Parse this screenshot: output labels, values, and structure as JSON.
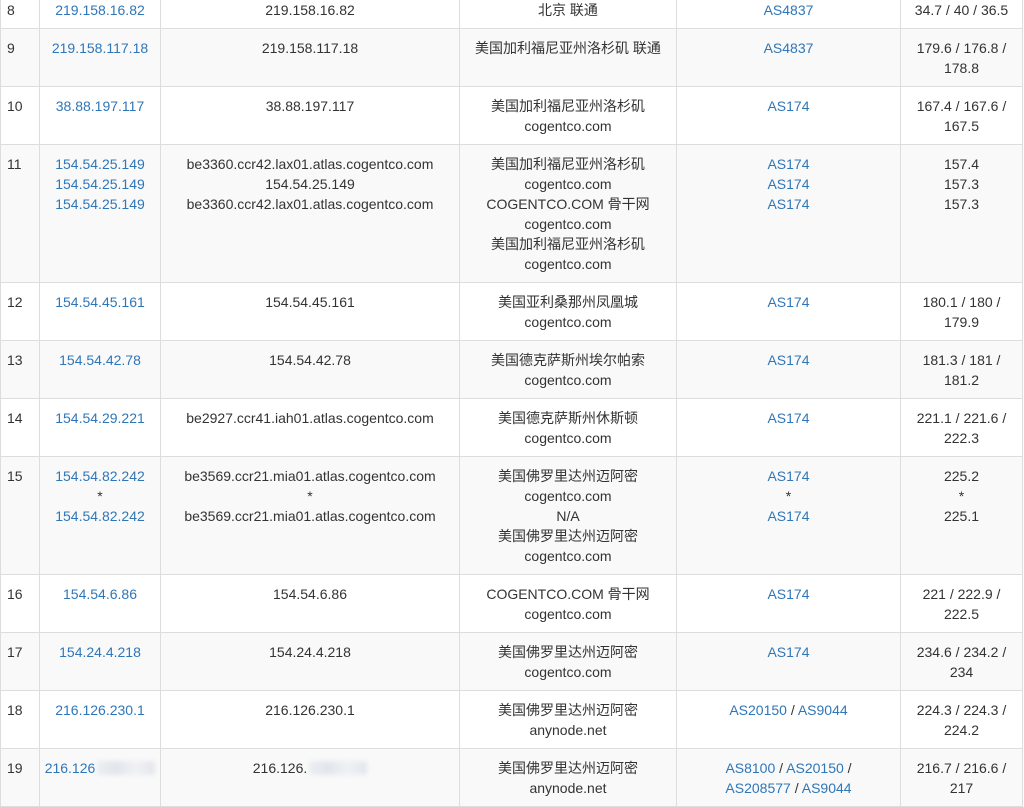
{
  "rows": [
    {
      "hop": "8",
      "ips": [
        "219.158.16.82"
      ],
      "hosts": [
        "219.158.16.82"
      ],
      "locs": [
        "北京 联通"
      ],
      "as": [
        [
          "AS4837"
        ]
      ],
      "rtt": [
        "34.7 / 40 / 36.5"
      ]
    },
    {
      "hop": "9",
      "ips": [
        "219.158.117.18"
      ],
      "hosts": [
        "219.158.117.18"
      ],
      "locs": [
        "美国加利福尼亚州洛杉矶 联通"
      ],
      "as": [
        [
          "AS4837"
        ]
      ],
      "rtt": [
        "179.6 / 176.8 /",
        "178.8"
      ]
    },
    {
      "hop": "10",
      "ips": [
        "38.88.197.117"
      ],
      "hosts": [
        "38.88.197.117"
      ],
      "locs": [
        "美国加利福尼亚州洛杉矶",
        "cogentco.com"
      ],
      "as": [
        [
          "AS174"
        ]
      ],
      "rtt": [
        "167.4 / 167.6 /",
        "167.5"
      ]
    },
    {
      "hop": "11",
      "ips": [
        "154.54.25.149",
        "154.54.25.149",
        "154.54.25.149"
      ],
      "hosts": [
        "be3360.ccr42.lax01.atlas.cogentco.com",
        "154.54.25.149",
        "be3360.ccr42.lax01.atlas.cogentco.com"
      ],
      "locs": [
        "美国加利福尼亚州洛杉矶",
        "cogentco.com",
        "COGENTCO.COM 骨干网",
        "cogentco.com",
        "美国加利福尼亚州洛杉矶",
        "cogentco.com"
      ],
      "as": [
        [
          "AS174"
        ],
        [
          "AS174"
        ],
        [
          "AS174"
        ]
      ],
      "rtt": [
        "157.4",
        "157.3",
        "157.3"
      ]
    },
    {
      "hop": "12",
      "ips": [
        "154.54.45.161"
      ],
      "hosts": [
        "154.54.45.161"
      ],
      "locs": [
        "美国亚利桑那州凤凰城",
        "cogentco.com"
      ],
      "as": [
        [
          "AS174"
        ]
      ],
      "rtt": [
        "180.1 / 180 /",
        "179.9"
      ]
    },
    {
      "hop": "13",
      "ips": [
        "154.54.42.78"
      ],
      "hosts": [
        "154.54.42.78"
      ],
      "locs": [
        "美国德克萨斯州埃尔帕索",
        "cogentco.com"
      ],
      "as": [
        [
          "AS174"
        ]
      ],
      "rtt": [
        "181.3 / 181 /",
        "181.2"
      ]
    },
    {
      "hop": "14",
      "ips": [
        "154.54.29.221"
      ],
      "hosts": [
        "be2927.ccr41.iah01.atlas.cogentco.com"
      ],
      "locs": [
        "美国德克萨斯州休斯顿",
        "cogentco.com"
      ],
      "as": [
        [
          "AS174"
        ]
      ],
      "rtt": [
        "221.1 / 221.6 /",
        "222.3"
      ]
    },
    {
      "hop": "15",
      "ips": [
        "154.54.82.242",
        "*",
        "154.54.82.242"
      ],
      "hosts": [
        "be3569.ccr21.mia01.atlas.cogentco.com",
        "*",
        "be3569.ccr21.mia01.atlas.cogentco.com"
      ],
      "locs": [
        "美国佛罗里达州迈阿密",
        "cogentco.com",
        "N/A",
        "美国佛罗里达州迈阿密",
        "cogentco.com"
      ],
      "as": [
        [
          "AS174"
        ],
        [
          "*"
        ],
        [
          "AS174"
        ]
      ],
      "rtt": [
        "225.2",
        "*",
        "225.1"
      ]
    },
    {
      "hop": "16",
      "ips": [
        "154.54.6.86"
      ],
      "hosts": [
        "154.54.6.86"
      ],
      "locs": [
        "COGENTCO.COM 骨干网",
        "cogentco.com"
      ],
      "as": [
        [
          "AS174"
        ]
      ],
      "rtt": [
        "221 / 222.9 /",
        "222.5"
      ]
    },
    {
      "hop": "17",
      "ips": [
        "154.24.4.218"
      ],
      "hosts": [
        "154.24.4.218"
      ],
      "locs": [
        "美国佛罗里达州迈阿密",
        "cogentco.com"
      ],
      "as": [
        [
          "AS174"
        ]
      ],
      "rtt": [
        "234.6 / 234.2 /",
        "234"
      ]
    },
    {
      "hop": "18",
      "ips": [
        "216.126.230.1"
      ],
      "hosts": [
        "216.126.230.1"
      ],
      "locs": [
        "美国佛罗里达州迈阿密",
        "anynode.net"
      ],
      "as": [
        [
          "AS20150",
          "AS9044"
        ]
      ],
      "rtt": [
        "224.3 / 224.3 /",
        "224.2"
      ]
    },
    {
      "hop": "19",
      "ips": [
        "216.126"
      ],
      "hosts": [
        "216.126."
      ],
      "locs": [
        "美国佛罗里达州迈阿密",
        "anynode.net"
      ],
      "as": [
        [
          "AS8100",
          "AS20150",
          ""
        ],
        [
          "AS208577",
          "AS9044"
        ]
      ],
      "rtt": [
        "216.7 / 216.6 /",
        "217"
      ],
      "redacted": true
    }
  ],
  "link_color": "#2f76b8",
  "alt_row_color": "#f9f9f9",
  "separator": " / "
}
